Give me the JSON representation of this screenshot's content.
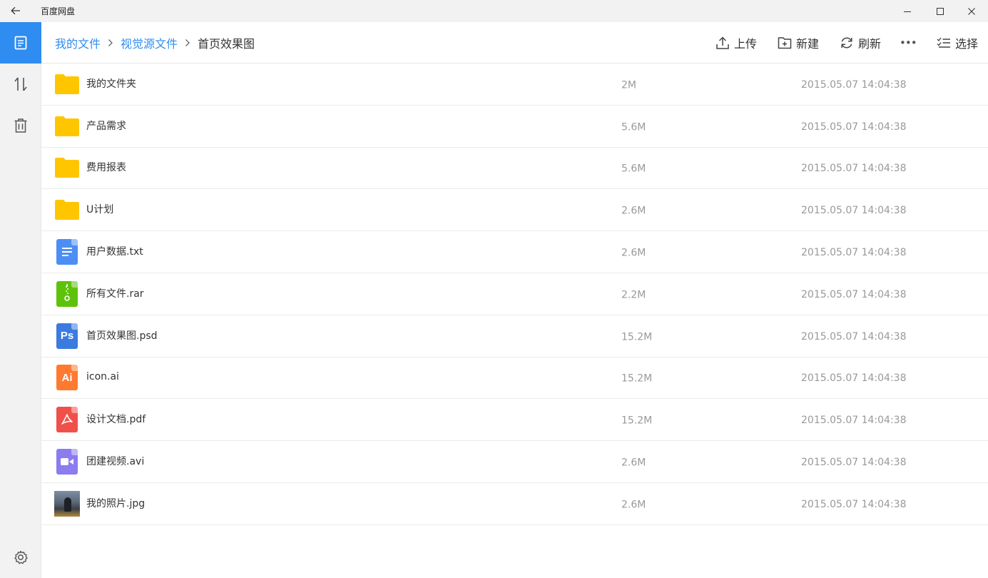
{
  "window": {
    "title": "百度网盘"
  },
  "breadcrumb": [
    {
      "label": "我的文件",
      "link": true
    },
    {
      "label": "视觉源文件",
      "link": true
    },
    {
      "label": "首页效果图",
      "link": false
    }
  ],
  "toolbar": {
    "upload": "上传",
    "new": "新建",
    "refresh": "刷新",
    "more": "•••",
    "select": "选择"
  },
  "files": [
    {
      "name": "我的文件夹",
      "size": "2M",
      "date": "2015.05.07  14:04:38",
      "type": "folder"
    },
    {
      "name": "产品需求",
      "size": "5.6M",
      "date": "2015.05.07  14:04:38",
      "type": "folder"
    },
    {
      "name": "费用报表",
      "size": "5.6M",
      "date": "2015.05.07  14:04:38",
      "type": "folder"
    },
    {
      "name": "U计划",
      "size": "2.6M",
      "date": "2015.05.07  14:04:38",
      "type": "folder"
    },
    {
      "name": "用户数据.txt",
      "size": "2.6M",
      "date": "2015.05.07  14:04:38",
      "type": "txt"
    },
    {
      "name": "所有文件.rar",
      "size": "2.2M",
      "date": "2015.05.07  14:04:38",
      "type": "rar"
    },
    {
      "name": "首页效果图.psd",
      "size": "15.2M",
      "date": "2015.05.07  14:04:38",
      "type": "psd",
      "icon_text": "Ps"
    },
    {
      "name": "icon.ai",
      "size": "15.2M",
      "date": "2015.05.07  14:04:38",
      "type": "ai",
      "icon_text": "Ai"
    },
    {
      "name": "设计文档.pdf",
      "size": "15.2M",
      "date": "2015.05.07  14:04:38",
      "type": "pdf"
    },
    {
      "name": "团建视频.avi",
      "size": "2.6M",
      "date": "2015.05.07  14:04:38",
      "type": "avi"
    },
    {
      "name": "我的照片.jpg",
      "size": "2.6M",
      "date": "2015.05.07  14:04:38",
      "type": "jpg"
    }
  ],
  "colors": {
    "accent": "#2f8cf0",
    "folder": "#ffc600",
    "txt": "#4d8ef5",
    "rar": "#5fc20a",
    "psd": "#3b7be0",
    "ai": "#ff7a30",
    "pdf": "#f0504a",
    "avi": "#8b7cf0"
  },
  "icons": {
    "titlebar_back": "arrow-left-icon",
    "sidebar": [
      "file-list-icon",
      "transfer-icon",
      "trash-icon",
      "settings-icon"
    ],
    "toolbar": [
      "upload-icon",
      "new-folder-icon",
      "refresh-icon",
      "more-icon",
      "select-list-icon"
    ]
  }
}
